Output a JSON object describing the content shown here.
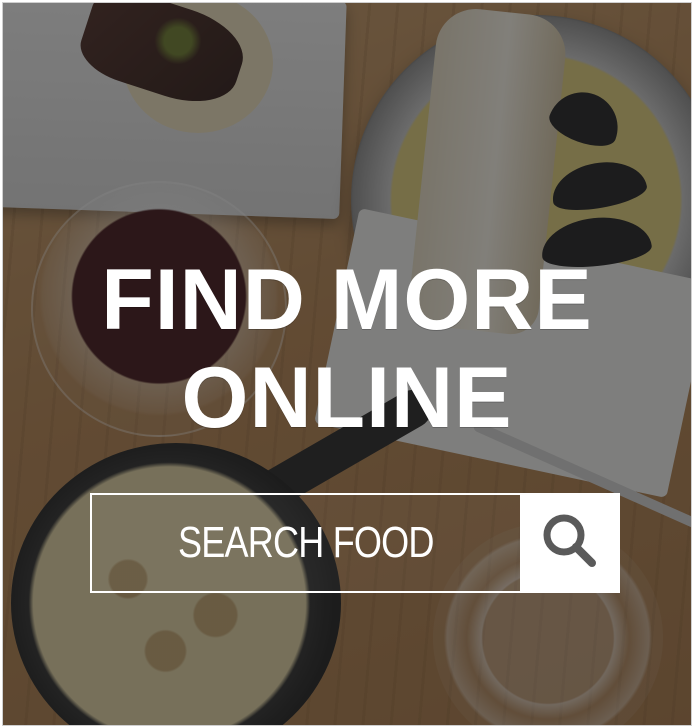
{
  "hero": {
    "headline_line1": "FIND MORE",
    "headline_line2": "ONLINE"
  },
  "search": {
    "label": "SEARCH FOOD",
    "button_icon": "search-icon"
  },
  "colors": {
    "text": "#ffffff",
    "overlay": "#1e1e1e",
    "button_bg": "#ffffff",
    "icon": "#5a5a5a"
  }
}
